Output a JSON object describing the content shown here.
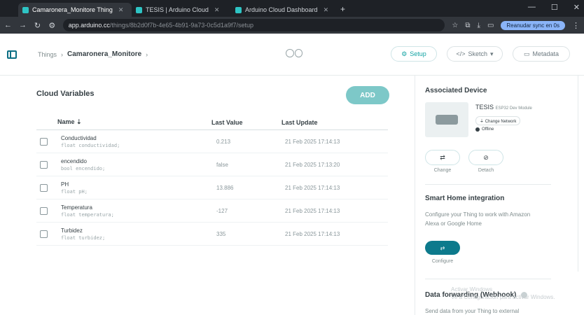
{
  "browser": {
    "tabs": [
      {
        "label": "Camaronera_Monitore Thing",
        "active": true
      },
      {
        "label": "TESIS | Arduino Cloud",
        "active": false
      },
      {
        "label": "Arduino Cloud Dashboard",
        "active": false
      }
    ],
    "new_tab": "+",
    "url_host": "app.arduino.cc",
    "url_path": "/things/8b2d0f7b-4e65-4b91-9a73-0c5d1a9f7/setup",
    "profile_label": "Reanudar sync en 0s",
    "window_controls": [
      "—",
      "☐",
      "✕"
    ]
  },
  "header": {
    "breadcrumb_root": "Things",
    "breadcrumb_current": "Camaronera_Monitore",
    "setup_label": "Setup",
    "sketch_label": "Sketch",
    "metadata_label": "Metadata"
  },
  "cloud_variables": {
    "title": "Cloud Variables",
    "add_label": "ADD",
    "columns": {
      "name": "Name ⇣",
      "last_value": "Last Value",
      "last_update": "Last Update"
    },
    "rows": [
      {
        "name": "Conductividad",
        "type": "float conductividad;",
        "value": "0.213",
        "updated": "21 Feb 2025 17:14:13"
      },
      {
        "name": "encendido",
        "type": "bool encendido;",
        "value": "false",
        "updated": "21 Feb 2025 17:13:20"
      },
      {
        "name": "PH",
        "type": "float pH;",
        "value": "13.886",
        "updated": "21 Feb 2025 17:14:13"
      },
      {
        "name": "Temperatura",
        "type": "float temperatura;",
        "value": "-127",
        "updated": "21 Feb 2025 17:14:13"
      },
      {
        "name": "Turbidez",
        "type": "float turbidez;",
        "value": "335",
        "updated": "21 Feb 2025 17:14:13"
      }
    ]
  },
  "device": {
    "section_title": "Associated Device",
    "name": "TESIS",
    "model": "ESP32 Dev Module",
    "change_network": "Change Network",
    "status": "Offline",
    "change_label": "Change",
    "detach_label": "Detach"
  },
  "smart_home": {
    "title": "Smart Home integration",
    "description": "Configure your Thing to work with Amazon Alexa or Google Home",
    "configure_label": "Configure"
  },
  "data_forwarding": {
    "title": "Data forwarding (Webhook)",
    "description": "Send data from your Thing to external"
  },
  "watermark": "Activar Windows\nVe a Configuración para activar Windows."
}
